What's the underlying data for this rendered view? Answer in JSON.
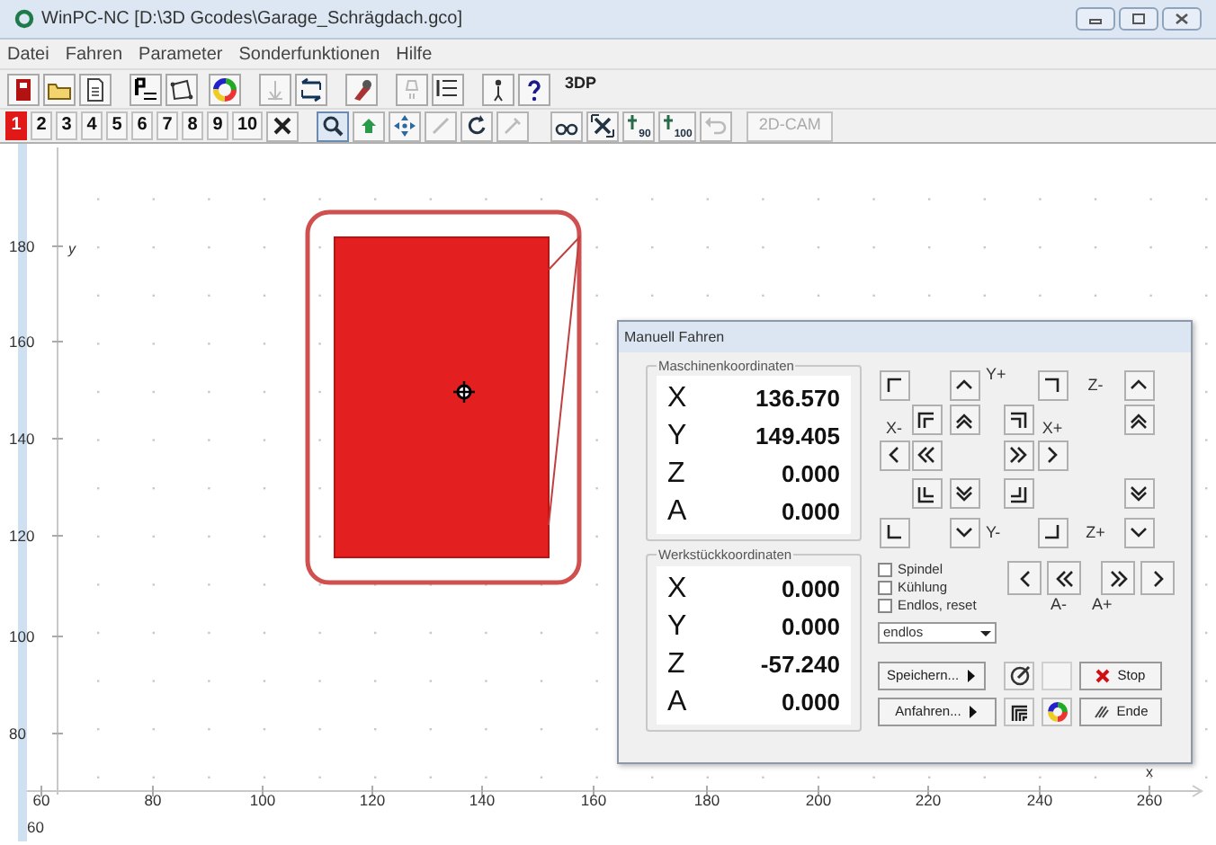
{
  "window": {
    "title": "WinPC-NC [D:\\3D Gcodes\\Garage_Schrägdach.gco]"
  },
  "menu": [
    "Datei",
    "Fahren",
    "Parameter",
    "Sonderfunktionen",
    "Hilfe"
  ],
  "toolbar_1": {
    "label": "3DP"
  },
  "toolbar_2": {
    "tabs": [
      {
        "label": "1",
        "selected": true
      },
      {
        "label": "2",
        "selected": false
      },
      {
        "label": "3",
        "selected": false
      },
      {
        "label": "4",
        "selected": false
      },
      {
        "label": "5",
        "selected": false
      },
      {
        "label": "6",
        "selected": false
      },
      {
        "label": "7",
        "selected": false
      },
      {
        "label": "8",
        "selected": false
      },
      {
        "label": "9",
        "selected": false
      },
      {
        "label": "10",
        "selected": false
      }
    ],
    "rotate_labels": [
      "90",
      "100"
    ],
    "cam_button": {
      "label": "2D-CAM",
      "disabled": true
    }
  },
  "canvas": {
    "y_ticks": [
      "180",
      "160",
      "140",
      "120",
      "100",
      "80"
    ],
    "x_ticks": [
      "60",
      "80",
      "100",
      "120",
      "140",
      "160",
      "180",
      "200",
      "220",
      "240",
      "260"
    ],
    "x_axis_label": "x",
    "y_axis_label": "y",
    "extra_label": "60"
  },
  "dialog": {
    "title": "Manuell Fahren",
    "machine_coordinates": {
      "title": "Maschinenkoordinaten",
      "rows": [
        {
          "axis": "X",
          "value": "136.570"
        },
        {
          "axis": "Y",
          "value": "149.405"
        },
        {
          "axis": "Z",
          "value": "0.000"
        },
        {
          "axis": "A",
          "value": "0.000"
        }
      ]
    },
    "workpiece_coordinates": {
      "title": "Werkstückkoordinaten",
      "rows": [
        {
          "axis": "X",
          "value": "0.000"
        },
        {
          "axis": "Y",
          "value": "0.000"
        },
        {
          "axis": "Z",
          "value": "-57.240"
        },
        {
          "axis": "A",
          "value": "0.000"
        }
      ]
    },
    "jog_labels": [
      "Y+",
      "Z-",
      "X-",
      "X+",
      "Y-",
      "Z+"
    ],
    "options": [
      {
        "label": "Spindel",
        "checked": false
      },
      {
        "label": "Kühlung",
        "checked": false
      },
      {
        "label": "Endlos, reset",
        "checked": false
      }
    ],
    "mode_select": {
      "value": "endlos"
    },
    "a_labels": [
      "A-",
      "A+"
    ],
    "buttons": {
      "save": "Speichern...",
      "approach": "Anfahren...",
      "stop": "Stop",
      "end": "Ende"
    }
  }
}
